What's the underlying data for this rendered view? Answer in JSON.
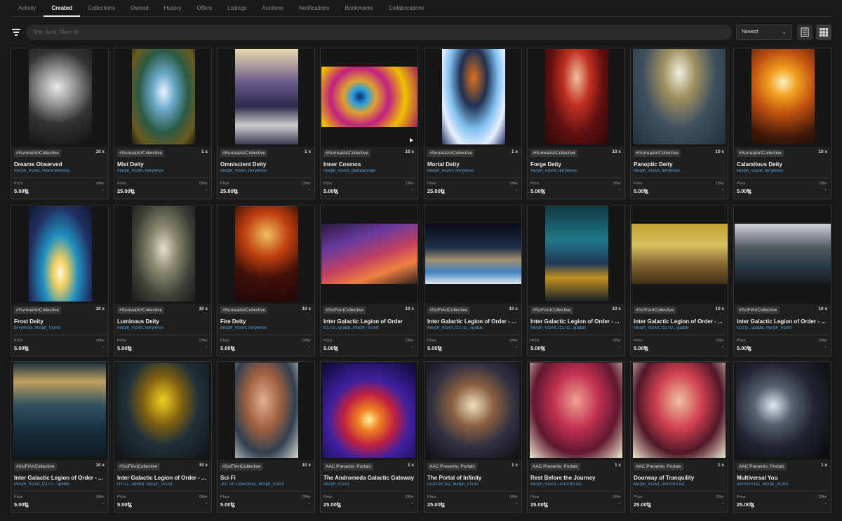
{
  "tabs": [
    "Activity",
    "Created",
    "Collections",
    "Owned",
    "History",
    "Offers",
    "Listings",
    "Auctions",
    "Notifications",
    "Bookmarks",
    "Collaborations"
  ],
  "active_tab": "Created",
  "search": {
    "placeholder": "Title, Artist, Token ID"
  },
  "sort": {
    "value": "Newest"
  },
  "icons": {
    "filter": "filter-icon",
    "list_view": "list-view-icon",
    "grid_view": "grid-view-icon",
    "dropdown": "chevron-down-icon",
    "play": "play-icon"
  },
  "labels": {
    "price": "Price",
    "offer": "Offer"
  },
  "cards": [
    {
      "tag": "#SurrealArtCollective",
      "editions": "10 x",
      "title": "Dreams Observed",
      "artists": "Morph_VGArt, Weird Momma",
      "price": "5.00ꜩ",
      "offer": "-",
      "shape": "portrait"
    },
    {
      "tag": "#SurrealArtCollective",
      "editions": "1 x",
      "title": "Mist Deity",
      "artists": "Morph_VGArt, terrylknox",
      "price": "25.00ꜩ",
      "offer": "-",
      "shape": "portrait"
    },
    {
      "tag": "#SurrealArtCollective",
      "editions": "1 x",
      "title": "Omniscient Deity",
      "artists": "Morph_VGArt, terrylknox",
      "price": "25.00ꜩ",
      "offer": "-",
      "shape": "portrait"
    },
    {
      "tag": "#SurrealArtCollective",
      "editions": "10 x",
      "title": "Inner Cosmos",
      "artists": "Morph_VGArt, poeticoncept",
      "price": "5.00ꜩ",
      "offer": "-",
      "shape": "wide",
      "video": true
    },
    {
      "tag": "#SurrealArtCollective",
      "editions": "1 x",
      "title": "Mortal Deity",
      "artists": "Morph_VGArt, terrylknox",
      "price": "25.00ꜩ",
      "offer": "-",
      "shape": "portrait"
    },
    {
      "tag": "#SurrealArtCollective",
      "editions": "10 x",
      "title": "Forge Deity",
      "artists": "Morph_VGArt, terrylknox",
      "price": "5.00ꜩ",
      "offer": "-",
      "shape": "portrait"
    },
    {
      "tag": "#SurrealArtCollective",
      "editions": "10 x",
      "title": "Panoptic Deity",
      "artists": "Morph_VGArt, terrylknox",
      "price": "5.00ꜩ",
      "offer": "-",
      "shape": "square"
    },
    {
      "tag": "#SurrealArtCollective",
      "editions": "10 x",
      "title": "Calamitous Deity",
      "artists": "Morph_VGArt, terrylknox",
      "price": "5.00ꜩ",
      "offer": "-",
      "shape": "portrait"
    },
    {
      "tag": "#SurrealArtCollective",
      "editions": "10 x",
      "title": "Frost Deity",
      "artists": "terrylknox, Morph_VGArt",
      "price": "5.00ꜩ",
      "offer": "-",
      "shape": "portrait"
    },
    {
      "tag": "#SurrealArtCollective",
      "editions": "10 x",
      "title": "Luminous Deity",
      "artists": "Morph_VGArt, terrylknox",
      "price": "5.00ꜩ",
      "offer": "-",
      "shape": "portrait"
    },
    {
      "tag": "#SurrealArtCollective",
      "editions": "10 x",
      "title": "Fire Deity",
      "artists": "Morph_VGArt, terrylknox",
      "price": "5.00ꜩ",
      "offer": "-",
      "shape": "portrait"
    },
    {
      "tag": "#SciFiArtCollective",
      "editions": "10 x",
      "title": "Inter Galactic Legion of Order",
      "artists": "tz1TD...vp8BB, Morph_VGArt",
      "price": "5.00ꜩ",
      "offer": "-",
      "shape": "wide"
    },
    {
      "tag": "#SciFiArtCollective",
      "editions": "10 x",
      "title": "Inter Galactic Legion of Order - ...",
      "artists": "Morph_VGArt, tz1TD...vp8BB",
      "price": "5.00ꜩ",
      "offer": "-",
      "shape": "wide"
    },
    {
      "tag": "#SciFiArtCollective",
      "editions": "10 x",
      "title": "Inter Galactic Legion of Order - ...",
      "artists": "Morph_VGArt, tz1TD...vp8BB",
      "price": "5.00ꜩ",
      "offer": "-",
      "shape": "portrait"
    },
    {
      "tag": "#SciFiArtCollective",
      "editions": "10 x",
      "title": "Inter Galactic Legion of Order - ...",
      "artists": "Morph_VGArt, tz1TD...vp8BB",
      "price": "5.00ꜩ",
      "offer": "-",
      "shape": "wide"
    },
    {
      "tag": "#SciFiArtCollective",
      "editions": "10 x",
      "title": "Inter Galactic Legion of Order - ...",
      "artists": "tz1TD...vp8BB, Morph_VGArt",
      "price": "5.00ꜩ",
      "offer": "-",
      "shape": "wide"
    },
    {
      "tag": "#SciFiArtCollective",
      "editions": "10 x",
      "title": "Inter Galactic Legion of Order - ...",
      "artists": "Morph_VGArt, tz1TD...vp8BB",
      "price": "5.00ꜩ",
      "offer": "-",
      "shape": "square"
    },
    {
      "tag": "#SciFiArtCollective",
      "editions": "10 x",
      "title": "Inter Galactic Legion of Order - ...",
      "artists": "tz1TD...vp8BB, Morph_VGArt",
      "price": "5.00ꜩ",
      "offer": "-",
      "shape": "square"
    },
    {
      "tag": "#SciFiArtCollective",
      "editions": "10 x",
      "title": "Sci-Fi",
      "artists": "JFC Art Collections, Morph_VGArt",
      "price": "5.00ꜩ",
      "offer": "-",
      "shape": "portrait"
    },
    {
      "tag": "AAC Presents: Portals",
      "editions": "1 x",
      "title": "The Andromeda Galactic Gateway",
      "artists": "Morph_VGArt",
      "price": "25.00ꜩ",
      "offer": "-",
      "shape": "square"
    },
    {
      "tag": "AAC Presents: Portals",
      "editions": "1 x",
      "title": "The Portal of Infinity",
      "artists": "un1tz3r0.tez, Morph_VGArt",
      "price": "25.00ꜩ",
      "offer": "-",
      "shape": "square"
    },
    {
      "tag": "AAC Presents: Portals",
      "editions": "1 x",
      "title": "Rest Before the Journey",
      "artists": "Morph_VGArt, un1tz3r0.tez",
      "price": "25.00ꜩ",
      "offer": "-",
      "shape": "square"
    },
    {
      "tag": "AAC Presents: Portals",
      "editions": "1 x",
      "title": "Doorway of Tranquility",
      "artists": "Morph_VGArt, un1tz3r0.tez",
      "price": "25.00ꜩ",
      "offer": "-",
      "shape": "square"
    },
    {
      "tag": "AAC Presents: Portals",
      "editions": "1 x",
      "title": "Multiversal You",
      "artists": "un1tz3r0.tez, Morph_VGArt",
      "price": "25.00ꜩ",
      "offer": "-",
      "shape": "square"
    }
  ]
}
